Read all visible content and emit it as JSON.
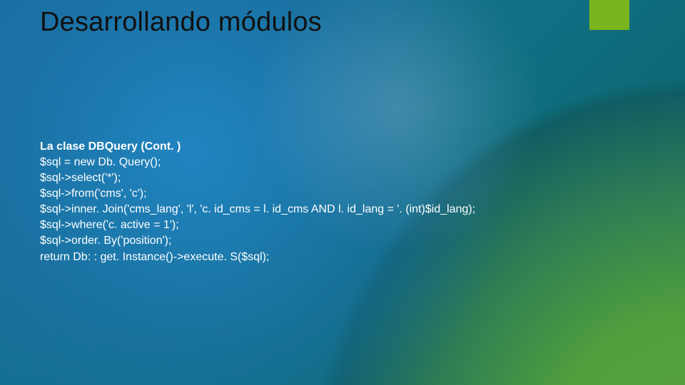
{
  "title": "Desarrollando módulos",
  "section_heading": "La clase DBQuery (Cont. )",
  "code_lines": [
    "$sql = new Db. Query();",
    "$sql->select('*');",
    "$sql->from('cms', 'c');",
    "$sql->inner. Join('cms_lang', 'l', 'c. id_cms = l. id_cms AND l. id_lang = '. (int)$id_lang);",
    "$sql->where('c. active = 1');",
    "$sql->order. By('position');",
    "return Db: : get. Instance()->execute. S($sql);"
  ]
}
